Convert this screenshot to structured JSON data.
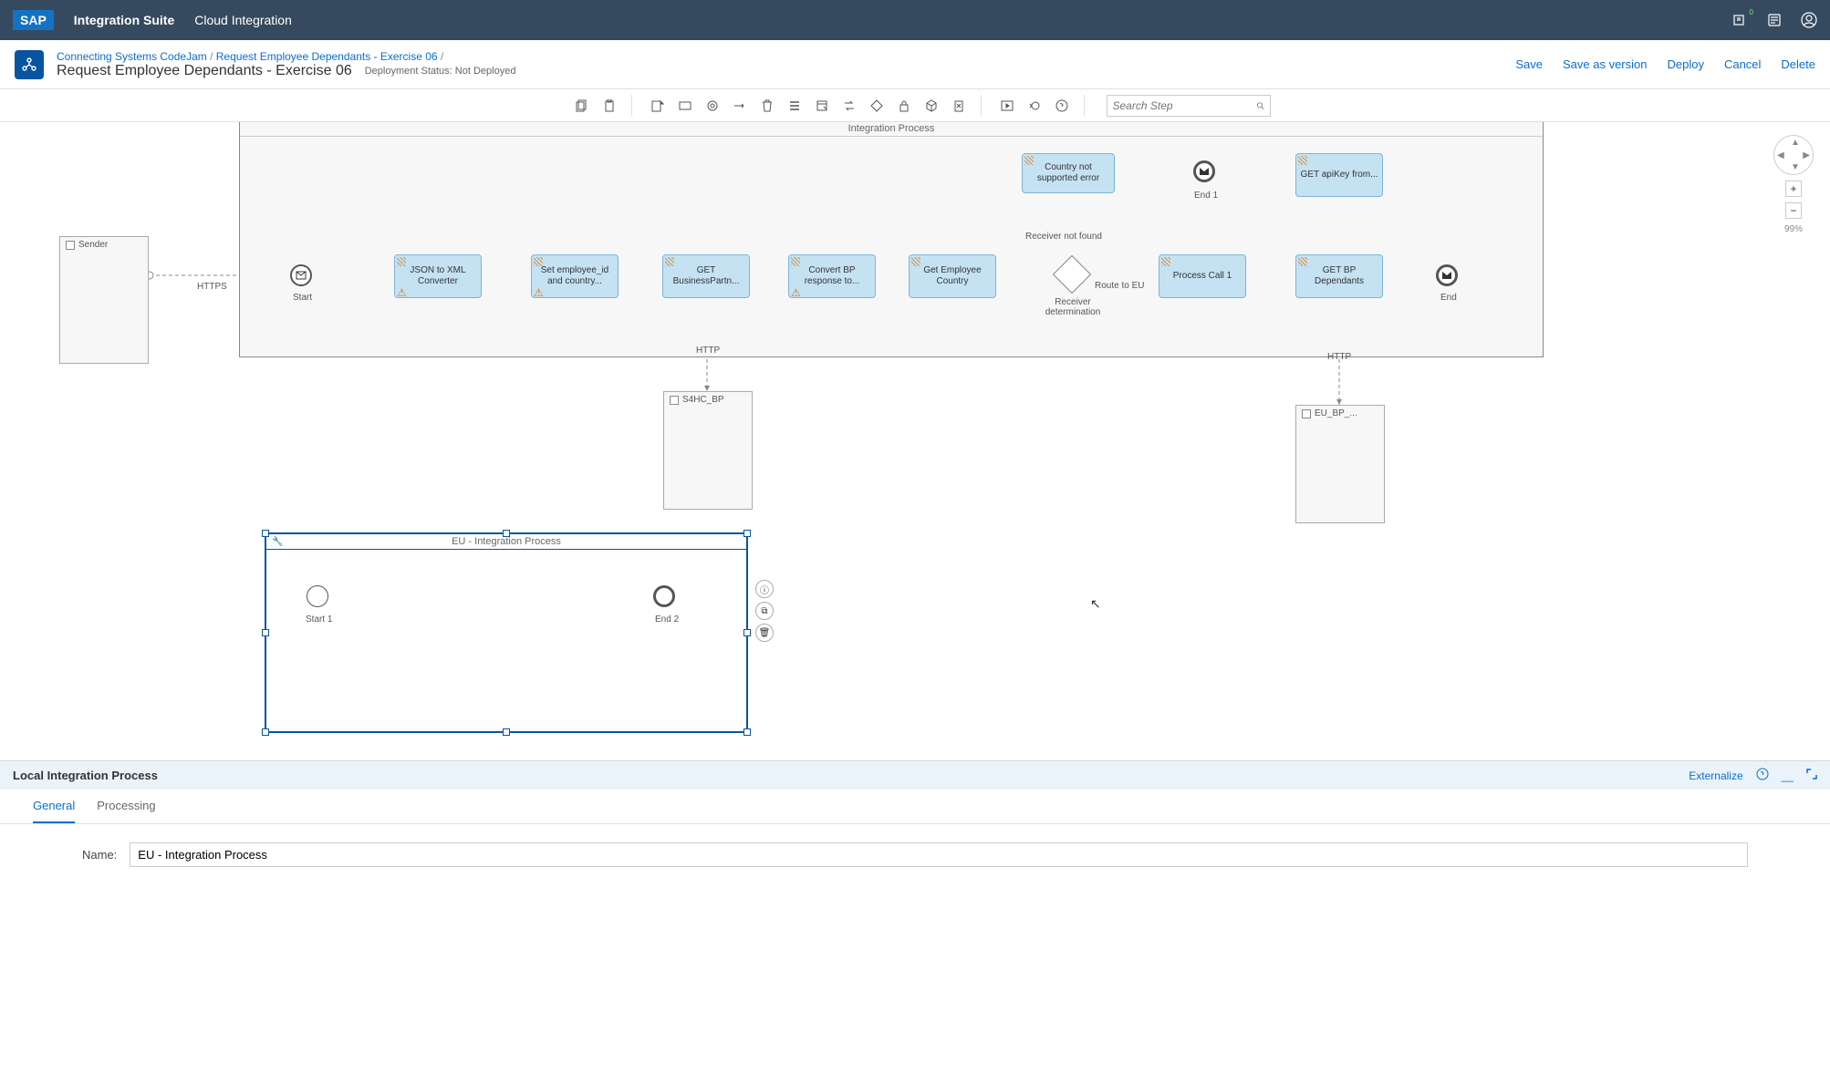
{
  "topbar": {
    "suite": "Integration Suite",
    "module": "Cloud Integration"
  },
  "breadcrumb": {
    "parent": "Connecting Systems CodeJam",
    "child": "Request Employee Dependants - Exercise 06",
    "sep": " / "
  },
  "page": {
    "title": "Request Employee Dependants - Exercise 06",
    "status_label": "Deployment Status:",
    "status_value": "Not Deployed"
  },
  "actions": {
    "save": "Save",
    "save_version": "Save as version",
    "deploy": "Deploy",
    "cancel": "Cancel",
    "delete": "Delete"
  },
  "search_placeholder": "Search Step",
  "zoom": "99%",
  "participants": {
    "sender": "Sender",
    "s4hc": "S4HC_BP",
    "eubp": "EU_BP_..."
  },
  "process_label": "Integration Process",
  "connections": {
    "https": "HTTPS",
    "http1": "HTTP",
    "http2": "HTTP",
    "route_eu": "Route to EU",
    "receiver_not_found": "Receiver not found"
  },
  "events": {
    "start": "Start",
    "end1": "End 1",
    "end": "End",
    "start1": "Start 1",
    "end2": "End 2"
  },
  "gateway_label": "Receiver determination",
  "nodes": {
    "json_xml": "JSON to XML Converter",
    "set_emp": "Set employee_id and country...",
    "get_bp": "GET BusinessPartn...",
    "convert_bp": "Convert BP response to...",
    "get_emp_ctry": "Get Employee Country",
    "country_err": "Country not supported error",
    "process_call": "Process Call 1",
    "get_apikey": "GET apiKey from...",
    "get_bp_dep": "GET BP Dependants"
  },
  "local_process": {
    "title": "EU - Integration Process"
  },
  "panel": {
    "title": "Local Integration Process",
    "externalize": "Externalize",
    "tabs": {
      "general": "General",
      "processing": "Processing"
    },
    "name_label": "Name:",
    "name_value": "EU - Integration Process"
  }
}
